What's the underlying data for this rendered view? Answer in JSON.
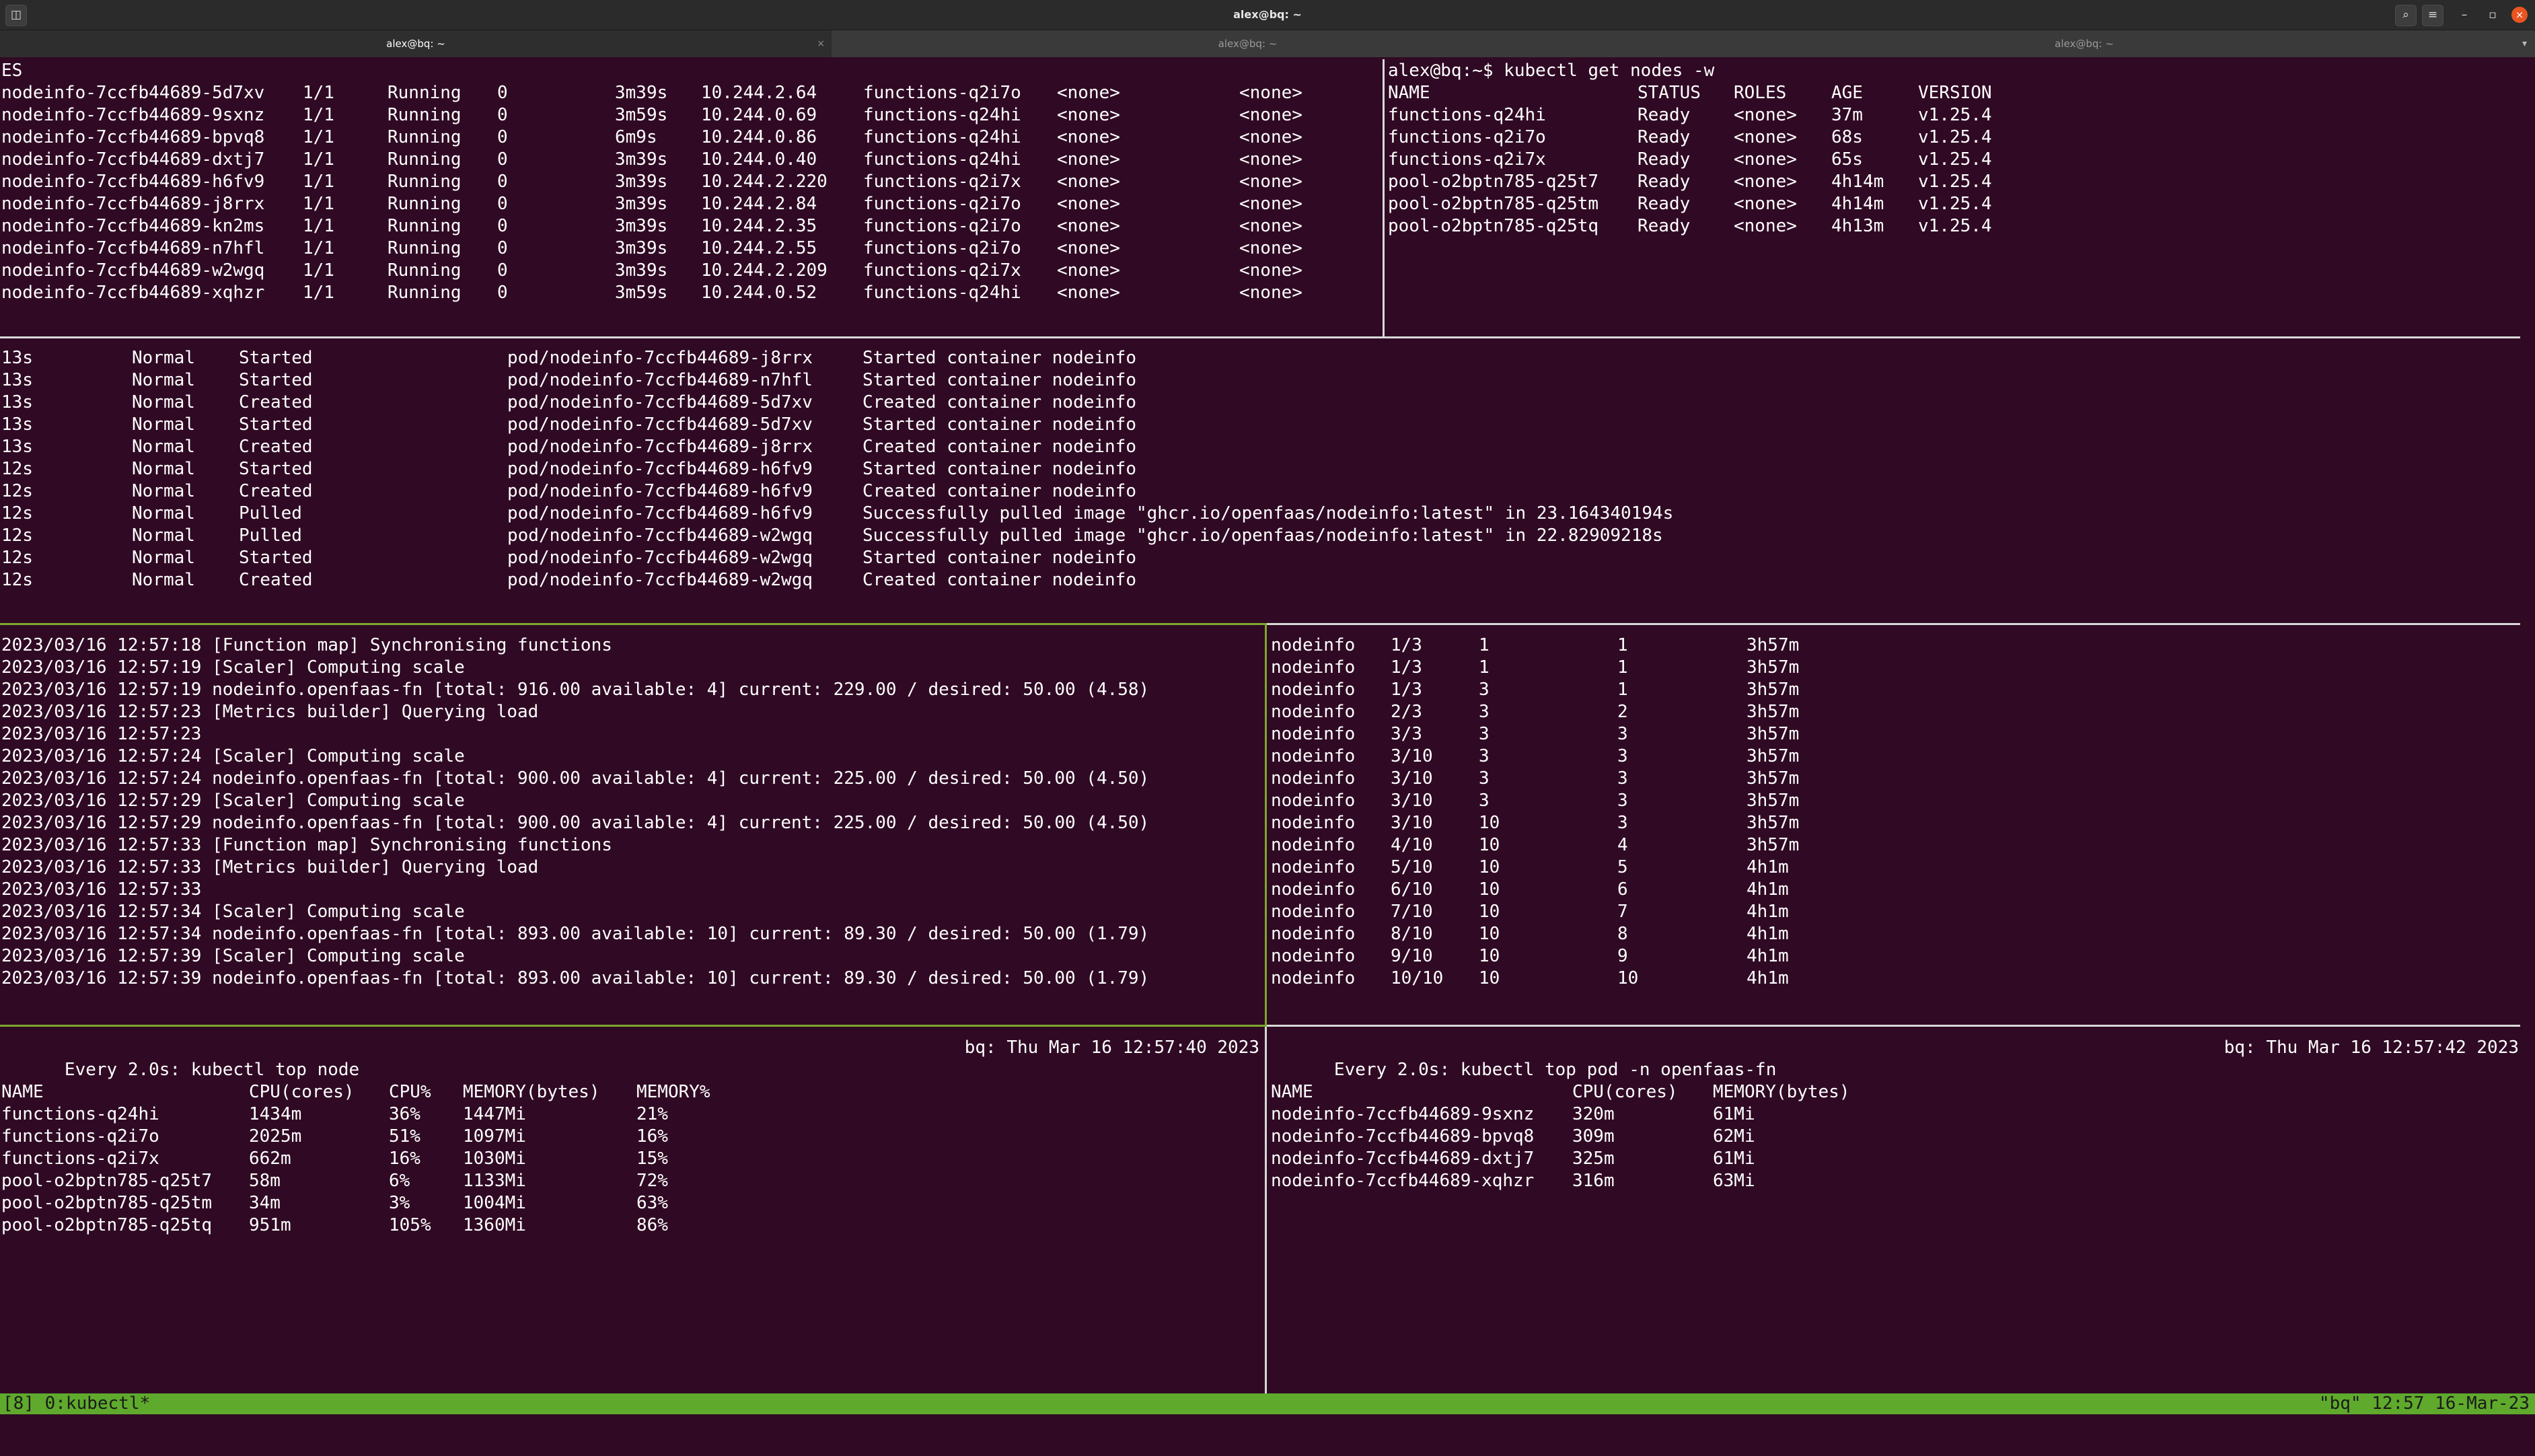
{
  "window": {
    "title": "alex@bq: ~",
    "tabs": [
      {
        "label": "alex@bq: ~",
        "active": true
      },
      {
        "label": "alex@bq: ~",
        "active": false
      },
      {
        "label": "alex@bq: ~",
        "active": false
      }
    ],
    "controls": {
      "search": "⌕",
      "menu": "≡",
      "minimize": "–",
      "maximize": "▫",
      "close": "×",
      "tab_close": "×",
      "tab_list": "▾"
    },
    "icons": [
      "terminal-icon",
      "search-icon",
      "hamburger-menu-icon",
      "minimize-icon",
      "maximize-icon",
      "close-icon"
    ]
  },
  "pods_pane": {
    "first_line": "ES",
    "rows": [
      [
        "nodeinfo-7ccfb44689-5d7xv",
        "1/1",
        "Running",
        "0",
        "3m39s",
        "10.244.2.64",
        "functions-q2i7o",
        "<none>",
        "<none>"
      ],
      [
        "nodeinfo-7ccfb44689-9sxnz",
        "1/1",
        "Running",
        "0",
        "3m59s",
        "10.244.0.69",
        "functions-q24hi",
        "<none>",
        "<none>"
      ],
      [
        "nodeinfo-7ccfb44689-bpvq8",
        "1/1",
        "Running",
        "0",
        "6m9s",
        "10.244.0.86",
        "functions-q24hi",
        "<none>",
        "<none>"
      ],
      [
        "nodeinfo-7ccfb44689-dxtj7",
        "1/1",
        "Running",
        "0",
        "3m39s",
        "10.244.0.40",
        "functions-q24hi",
        "<none>",
        "<none>"
      ],
      [
        "nodeinfo-7ccfb44689-h6fv9",
        "1/1",
        "Running",
        "0",
        "3m39s",
        "10.244.2.220",
        "functions-q2i7x",
        "<none>",
        "<none>"
      ],
      [
        "nodeinfo-7ccfb44689-j8rrx",
        "1/1",
        "Running",
        "0",
        "3m39s",
        "10.244.2.84",
        "functions-q2i7o",
        "<none>",
        "<none>"
      ],
      [
        "nodeinfo-7ccfb44689-kn2ms",
        "1/1",
        "Running",
        "0",
        "3m39s",
        "10.244.2.35",
        "functions-q2i7o",
        "<none>",
        "<none>"
      ],
      [
        "nodeinfo-7ccfb44689-n7hfl",
        "1/1",
        "Running",
        "0",
        "3m39s",
        "10.244.2.55",
        "functions-q2i7o",
        "<none>",
        "<none>"
      ],
      [
        "nodeinfo-7ccfb44689-w2wgq",
        "1/1",
        "Running",
        "0",
        "3m39s",
        "10.244.2.209",
        "functions-q2i7x",
        "<none>",
        "<none>"
      ],
      [
        "nodeinfo-7ccfb44689-xqhzr",
        "1/1",
        "Running",
        "0",
        "3m59s",
        "10.244.0.52",
        "functions-q24hi",
        "<none>",
        "<none>"
      ]
    ]
  },
  "nodes_pane": {
    "prompt": "alex@bq:~$ kubectl get nodes -w",
    "headers": [
      "NAME",
      "STATUS",
      "ROLES",
      "AGE",
      "VERSION"
    ],
    "rows": [
      [
        "functions-q24hi",
        "Ready",
        "<none>",
        "37m",
        "v1.25.4"
      ],
      [
        "functions-q2i7o",
        "Ready",
        "<none>",
        "68s",
        "v1.25.4"
      ],
      [
        "functions-q2i7x",
        "Ready",
        "<none>",
        "65s",
        "v1.25.4"
      ],
      [
        "pool-o2bptn785-q25t7",
        "Ready",
        "<none>",
        "4h14m",
        "v1.25.4"
      ],
      [
        "pool-o2bptn785-q25tm",
        "Ready",
        "<none>",
        "4h14m",
        "v1.25.4"
      ],
      [
        "pool-o2bptn785-q25tq",
        "Ready",
        "<none>",
        "4h13m",
        "v1.25.4"
      ]
    ]
  },
  "events_pane": {
    "rows": [
      [
        "13s",
        "Normal",
        "Started",
        "pod/nodeinfo-7ccfb44689-j8rrx",
        "Started container nodeinfo"
      ],
      [
        "13s",
        "Normal",
        "Started",
        "pod/nodeinfo-7ccfb44689-n7hfl",
        "Started container nodeinfo"
      ],
      [
        "13s",
        "Normal",
        "Created",
        "pod/nodeinfo-7ccfb44689-5d7xv",
        "Created container nodeinfo"
      ],
      [
        "13s",
        "Normal",
        "Started",
        "pod/nodeinfo-7ccfb44689-5d7xv",
        "Started container nodeinfo"
      ],
      [
        "13s",
        "Normal",
        "Created",
        "pod/nodeinfo-7ccfb44689-j8rrx",
        "Created container nodeinfo"
      ],
      [
        "12s",
        "Normal",
        "Started",
        "pod/nodeinfo-7ccfb44689-h6fv9",
        "Started container nodeinfo"
      ],
      [
        "12s",
        "Normal",
        "Created",
        "pod/nodeinfo-7ccfb44689-h6fv9",
        "Created container nodeinfo"
      ],
      [
        "12s",
        "Normal",
        "Pulled",
        "pod/nodeinfo-7ccfb44689-h6fv9",
        "Successfully pulled image \"ghcr.io/openfaas/nodeinfo:latest\" in 23.164340194s"
      ],
      [
        "12s",
        "Normal",
        "Pulled",
        "pod/nodeinfo-7ccfb44689-w2wgq",
        "Successfully pulled image \"ghcr.io/openfaas/nodeinfo:latest\" in 22.82909218s"
      ],
      [
        "12s",
        "Normal",
        "Started",
        "pod/nodeinfo-7ccfb44689-w2wgq",
        "Started container nodeinfo"
      ],
      [
        "12s",
        "Normal",
        "Created",
        "pod/nodeinfo-7ccfb44689-w2wgq",
        "Created container nodeinfo"
      ]
    ]
  },
  "logs_pane": {
    "lines": [
      "2023/03/16 12:57:18 [Function map] Synchronising functions",
      "2023/03/16 12:57:19 [Scaler] Computing scale",
      "2023/03/16 12:57:19 nodeinfo.openfaas-fn [total: 916.00 available: 4] current: 229.00 / desired: 50.00 (4.58)",
      "2023/03/16 12:57:23 [Metrics builder] Querying load",
      "2023/03/16 12:57:23",
      "2023/03/16 12:57:24 [Scaler] Computing scale",
      "2023/03/16 12:57:24 nodeinfo.openfaas-fn [total: 900.00 available: 4] current: 225.00 / desired: 50.00 (4.50)",
      "2023/03/16 12:57:29 [Scaler] Computing scale",
      "2023/03/16 12:57:29 nodeinfo.openfaas-fn [total: 900.00 available: 4] current: 225.00 / desired: 50.00 (4.50)",
      "2023/03/16 12:57:33 [Function map] Synchronising functions",
      "2023/03/16 12:57:33 [Metrics builder] Querying load",
      "2023/03/16 12:57:33",
      "2023/03/16 12:57:34 [Scaler] Computing scale",
      "2023/03/16 12:57:34 nodeinfo.openfaas-fn [total: 893.00 available: 10] current: 89.30 / desired: 50.00 (1.79)",
      "2023/03/16 12:57:39 [Scaler] Computing scale",
      "2023/03/16 12:57:39 nodeinfo.openfaas-fn [total: 893.00 available: 10] current: 89.30 / desired: 50.00 (1.79)"
    ]
  },
  "replicas_pane": {
    "rows": [
      [
        "nodeinfo",
        "1/3",
        "1",
        "1",
        "3h57m"
      ],
      [
        "nodeinfo",
        "1/3",
        "1",
        "1",
        "3h57m"
      ],
      [
        "nodeinfo",
        "1/3",
        "3",
        "1",
        "3h57m"
      ],
      [
        "nodeinfo",
        "2/3",
        "3",
        "2",
        "3h57m"
      ],
      [
        "nodeinfo",
        "3/3",
        "3",
        "3",
        "3h57m"
      ],
      [
        "nodeinfo",
        "3/10",
        "3",
        "3",
        "3h57m"
      ],
      [
        "nodeinfo",
        "3/10",
        "3",
        "3",
        "3h57m"
      ],
      [
        "nodeinfo",
        "3/10",
        "3",
        "3",
        "3h57m"
      ],
      [
        "nodeinfo",
        "3/10",
        "10",
        "3",
        "3h57m"
      ],
      [
        "nodeinfo",
        "4/10",
        "10",
        "4",
        "3h57m"
      ],
      [
        "nodeinfo",
        "5/10",
        "10",
        "5",
        "4h1m"
      ],
      [
        "nodeinfo",
        "6/10",
        "10",
        "6",
        "4h1m"
      ],
      [
        "nodeinfo",
        "7/10",
        "10",
        "7",
        "4h1m"
      ],
      [
        "nodeinfo",
        "8/10",
        "10",
        "8",
        "4h1m"
      ],
      [
        "nodeinfo",
        "9/10",
        "10",
        "9",
        "4h1m"
      ],
      [
        "nodeinfo",
        "10/10",
        "10",
        "10",
        "4h1m"
      ]
    ]
  },
  "top_node_pane": {
    "watch": "Every 2.0s: kubectl top node",
    "stamp": "bq: Thu Mar 16 12:57:40 2023",
    "headers": [
      "NAME",
      "CPU(cores)",
      "CPU%",
      "MEMORY(bytes)",
      "MEMORY%"
    ],
    "rows": [
      [
        "functions-q24hi",
        "1434m",
        "36%",
        "1447Mi",
        "21%"
      ],
      [
        "functions-q2i7o",
        "2025m",
        "51%",
        "1097Mi",
        "16%"
      ],
      [
        "functions-q2i7x",
        "662m",
        "16%",
        "1030Mi",
        "15%"
      ],
      [
        "pool-o2bptn785-q25t7",
        "58m",
        "6%",
        "1133Mi",
        "72%"
      ],
      [
        "pool-o2bptn785-q25tm",
        "34m",
        "3%",
        "1004Mi",
        "63%"
      ],
      [
        "pool-o2bptn785-q25tq",
        "951m",
        "105%",
        "1360Mi",
        "86%"
      ]
    ]
  },
  "top_pod_pane": {
    "watch": "Every 2.0s: kubectl top pod -n openfaas-fn",
    "stamp": "bq: Thu Mar 16 12:57:42 2023",
    "headers": [
      "NAME",
      "CPU(cores)",
      "MEMORY(bytes)"
    ],
    "rows": [
      [
        "nodeinfo-7ccfb44689-9sxnz",
        "320m",
        "61Mi"
      ],
      [
        "nodeinfo-7ccfb44689-bpvq8",
        "309m",
        "62Mi"
      ],
      [
        "nodeinfo-7ccfb44689-dxtj7",
        "325m",
        "61Mi"
      ],
      [
        "nodeinfo-7ccfb44689-xqhzr",
        "316m",
        "63Mi"
      ]
    ]
  },
  "tmux_status": {
    "left": "[8] 0:kubectl*",
    "right": "\"bq\" 12:57 16-Mar-23"
  },
  "colors": {
    "background": "#300a24",
    "text": "#ffffff",
    "status_bar": "#5faa2c",
    "active_pane_border": "#7ea82b",
    "pane_border": "#d8d8d8"
  }
}
